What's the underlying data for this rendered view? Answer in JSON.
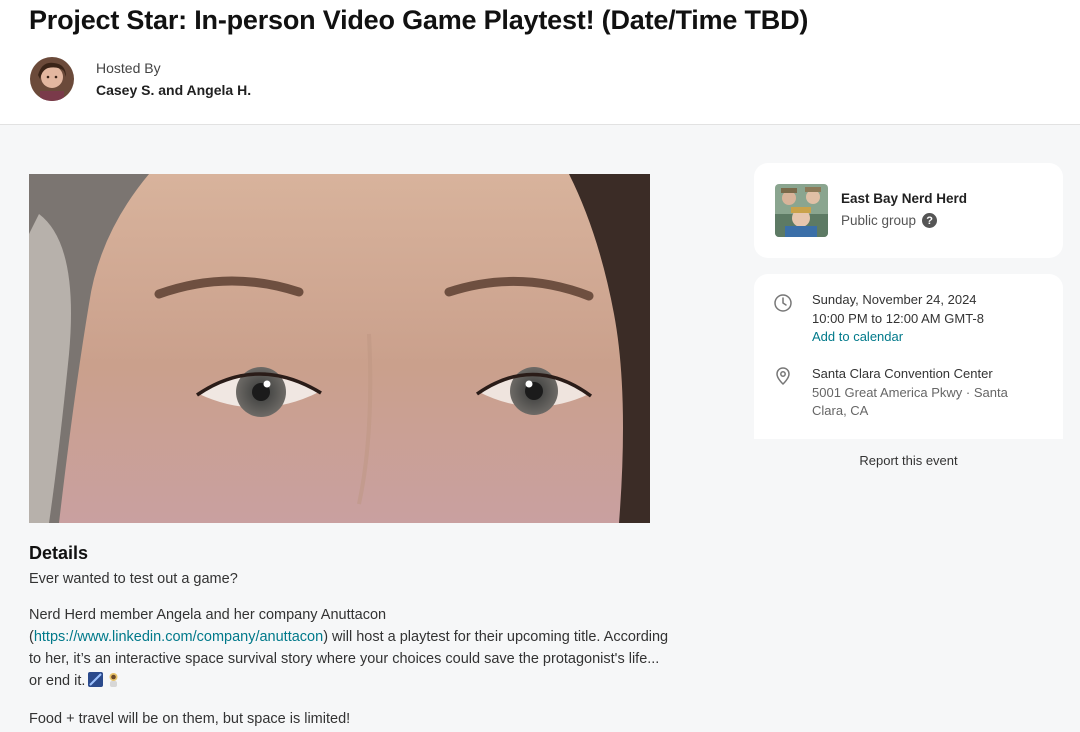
{
  "event": {
    "title": "Project Star: In-person Video Game Playtest! (Date/Time TBD)",
    "hosted_by_label": "Hosted By",
    "hosts": "Casey S. and Angela H."
  },
  "details": {
    "heading": "Details",
    "p1": "Ever wanted to test out a game?",
    "p2_before": "Nerd Herd member Angela and her company Anuttacon (",
    "p2_link": "https://www.linkedin.com/company/anuttacon",
    "p2_after": ") will host a playtest for their upcoming title. According to her, it’s an interactive space survival story where your choices could save the protagonist's life... or end it.",
    "p3": "Food + travel will be on them, but space is limited!"
  },
  "group": {
    "name": "East Bay Nerd Herd",
    "type": "Public group"
  },
  "when": {
    "date": "Sunday, November 24, 2024",
    "time": "10:00 PM to 12:00 AM GMT-8",
    "add_to_calendar": "Add to calendar"
  },
  "where": {
    "venue": "Santa Clara Convention Center",
    "address": "5001 Great America Pkwy · Santa Clara, CA"
  },
  "report_label": "Report this event",
  "colors": {
    "link": "#00798a",
    "page_bg": "#f6f7f8",
    "card_bg": "#ffffff"
  },
  "icons": [
    "clock-icon",
    "location-pin-icon",
    "help-icon"
  ]
}
